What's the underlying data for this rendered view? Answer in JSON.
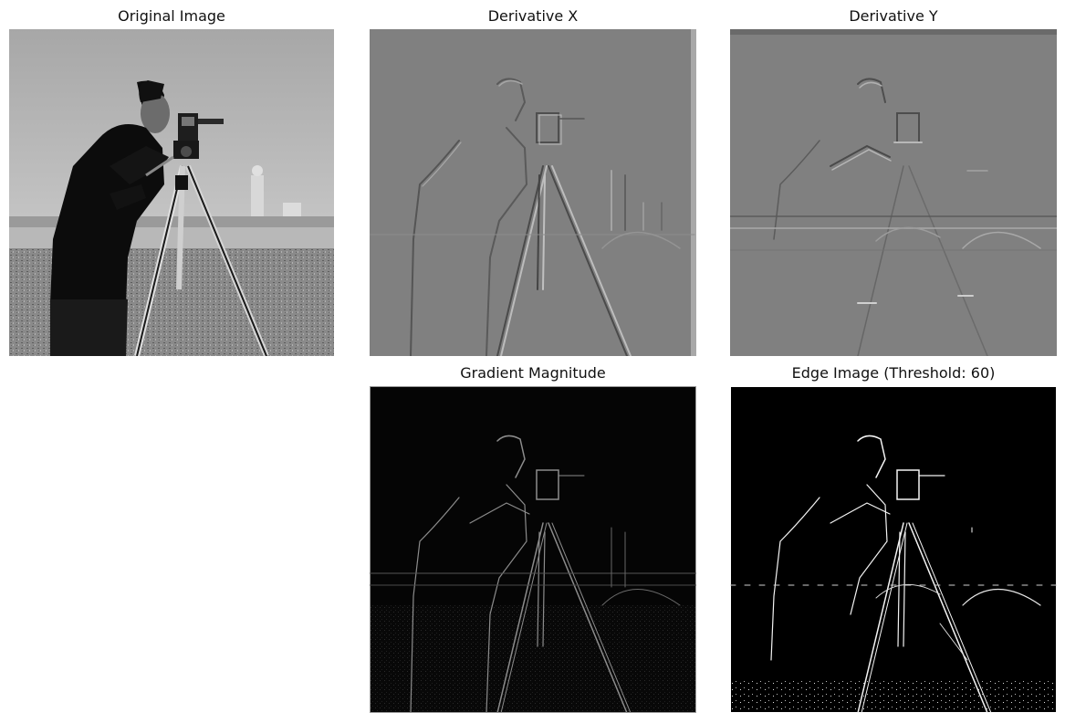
{
  "panels": {
    "original": {
      "title": "Original Image"
    },
    "derivative_x": {
      "title": "Derivative X"
    },
    "derivative_y": {
      "title": "Derivative Y"
    },
    "gradient_magnitude": {
      "title": "Gradient Magnitude"
    },
    "edge_image": {
      "title": "Edge Image (Threshold: 60)"
    }
  }
}
